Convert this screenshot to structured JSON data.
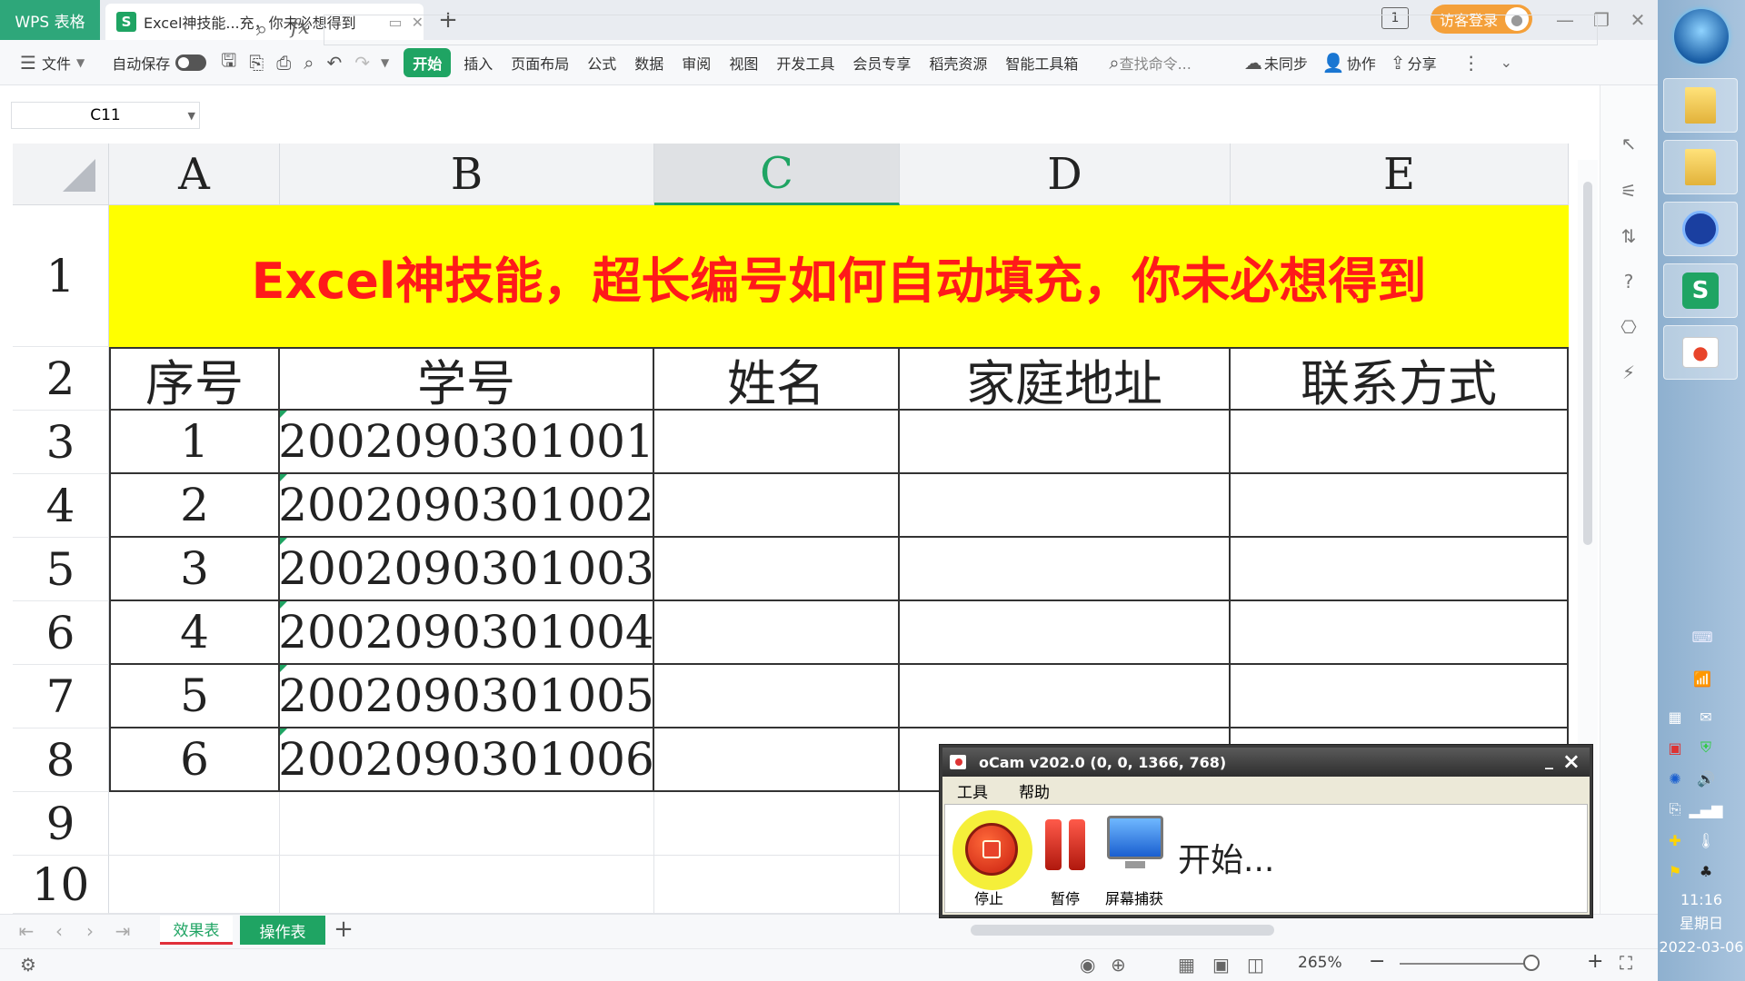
{
  "titlebar": {
    "app_tab": "WPS 表格",
    "doc_tab": "Excel神技能...充，你未必想得到",
    "window_number": "1",
    "guest_login": "访客登录"
  },
  "ribbon": {
    "file": "文件",
    "autosave": "自动保存",
    "menus": [
      "开始",
      "插入",
      "页面布局",
      "公式",
      "数据",
      "审阅",
      "视图",
      "开发工具",
      "会员专享",
      "稻壳资源",
      "智能工具箱"
    ],
    "search_placeholder": "查找命令...",
    "sync": "未同步",
    "collab": "协作",
    "share": "分享"
  },
  "formula_bar": {
    "cell_ref": "C11",
    "fx": "fx",
    "formula": ""
  },
  "grid": {
    "columns": [
      "A",
      "B",
      "C",
      "D",
      "E"
    ],
    "selected_column": "C",
    "rows": [
      "1",
      "2",
      "3",
      "4",
      "5",
      "6",
      "7",
      "8",
      "9",
      "10"
    ],
    "banner": "Excel神技能，超长编号如何自动填充，你未必想得到",
    "headers": [
      "序号",
      "学号",
      "姓名",
      "家庭地址",
      "联系方式"
    ],
    "data": [
      {
        "seq": "1",
        "id": "2002090301001"
      },
      {
        "seq": "2",
        "id": "2002090301002"
      },
      {
        "seq": "3",
        "id": "2002090301003"
      },
      {
        "seq": "4",
        "id": "2002090301004"
      },
      {
        "seq": "5",
        "id": "2002090301005"
      },
      {
        "seq": "6",
        "id": "2002090301006"
      }
    ]
  },
  "sheets": {
    "tabs": [
      "效果表",
      "操作表"
    ],
    "active": "效果表"
  },
  "status": {
    "zoom": "265%"
  },
  "ocam": {
    "title": "oCam v202.0 (0, 0, 1366, 768)",
    "menu": [
      "工具",
      "帮助"
    ],
    "stop": "停止",
    "pause": "暂停",
    "screen_capture": "屏幕捕获",
    "status": "开始..."
  },
  "taskbar": {
    "time": "11:16",
    "weekday": "星期日",
    "date": "2022-03-06"
  },
  "colors": {
    "wps_green": "#1fa463",
    "banner_bg": "#ffff00",
    "banner_text": "#ff1a1a",
    "guest_orange": "#f4a03a"
  }
}
